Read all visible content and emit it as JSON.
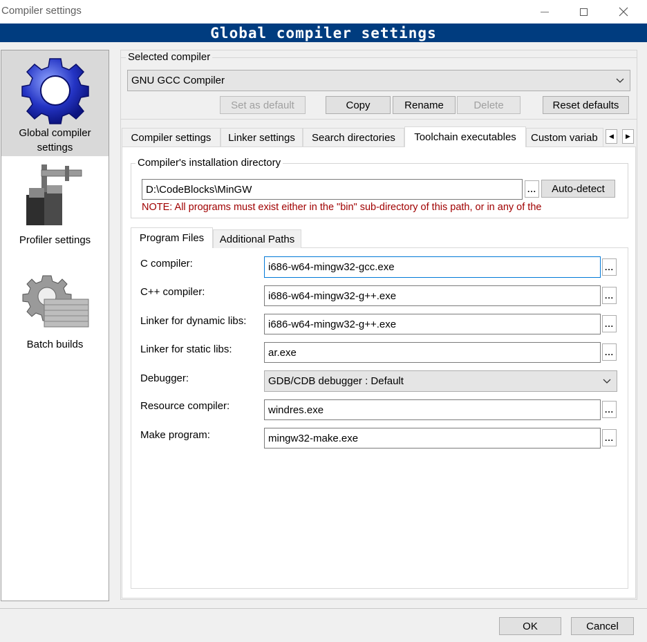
{
  "window": {
    "title": "Compiler settings"
  },
  "banner": {
    "title": "Global compiler settings"
  },
  "nav": {
    "items": [
      {
        "label_line1": "Global compiler",
        "label_line2": "settings"
      },
      {
        "label": "Profiler settings"
      },
      {
        "label": "Batch builds"
      }
    ]
  },
  "selected_compiler": {
    "group_label": "Selected compiler",
    "value": "GNU GCC Compiler",
    "buttons": {
      "set_default": "Set as default",
      "copy": "Copy",
      "rename": "Rename",
      "delete": "Delete",
      "reset": "Reset defaults"
    }
  },
  "tabs": [
    {
      "label": "Compiler settings"
    },
    {
      "label": "Linker settings"
    },
    {
      "label": "Search directories"
    },
    {
      "label": "Toolchain executables"
    },
    {
      "label": "Custom variab"
    }
  ],
  "install_dir": {
    "group_label": "Compiler's installation directory",
    "value": "D:\\CodeBlocks\\MinGW",
    "browse": "...",
    "autodetect": "Auto-detect",
    "note": "NOTE: All programs must exist either in the \"bin\" sub-directory of this path, or in any of the"
  },
  "subtabs": [
    {
      "label": "Program Files"
    },
    {
      "label": "Additional Paths"
    }
  ],
  "programs": {
    "c_compiler": {
      "label": "C compiler:",
      "value": "i686-w64-mingw32-gcc.exe"
    },
    "cpp_compiler": {
      "label": "C++ compiler:",
      "value": "i686-w64-mingw32-g++.exe"
    },
    "linker_dynamic": {
      "label": "Linker for dynamic libs:",
      "value": "i686-w64-mingw32-g++.exe"
    },
    "linker_static": {
      "label": "Linker for static libs:",
      "value": "ar.exe"
    },
    "debugger": {
      "label": "Debugger:",
      "value": "GDB/CDB debugger : Default"
    },
    "resource_compiler": {
      "label": "Resource compiler:",
      "value": "windres.exe"
    },
    "make_program": {
      "label": "Make program:",
      "value": "mingw32-make.exe"
    },
    "browse": "..."
  },
  "footer": {
    "ok": "OK",
    "cancel": "Cancel"
  },
  "colors": {
    "banner": "#003c7f",
    "note": "#a00000",
    "focus": "#0078d7"
  }
}
